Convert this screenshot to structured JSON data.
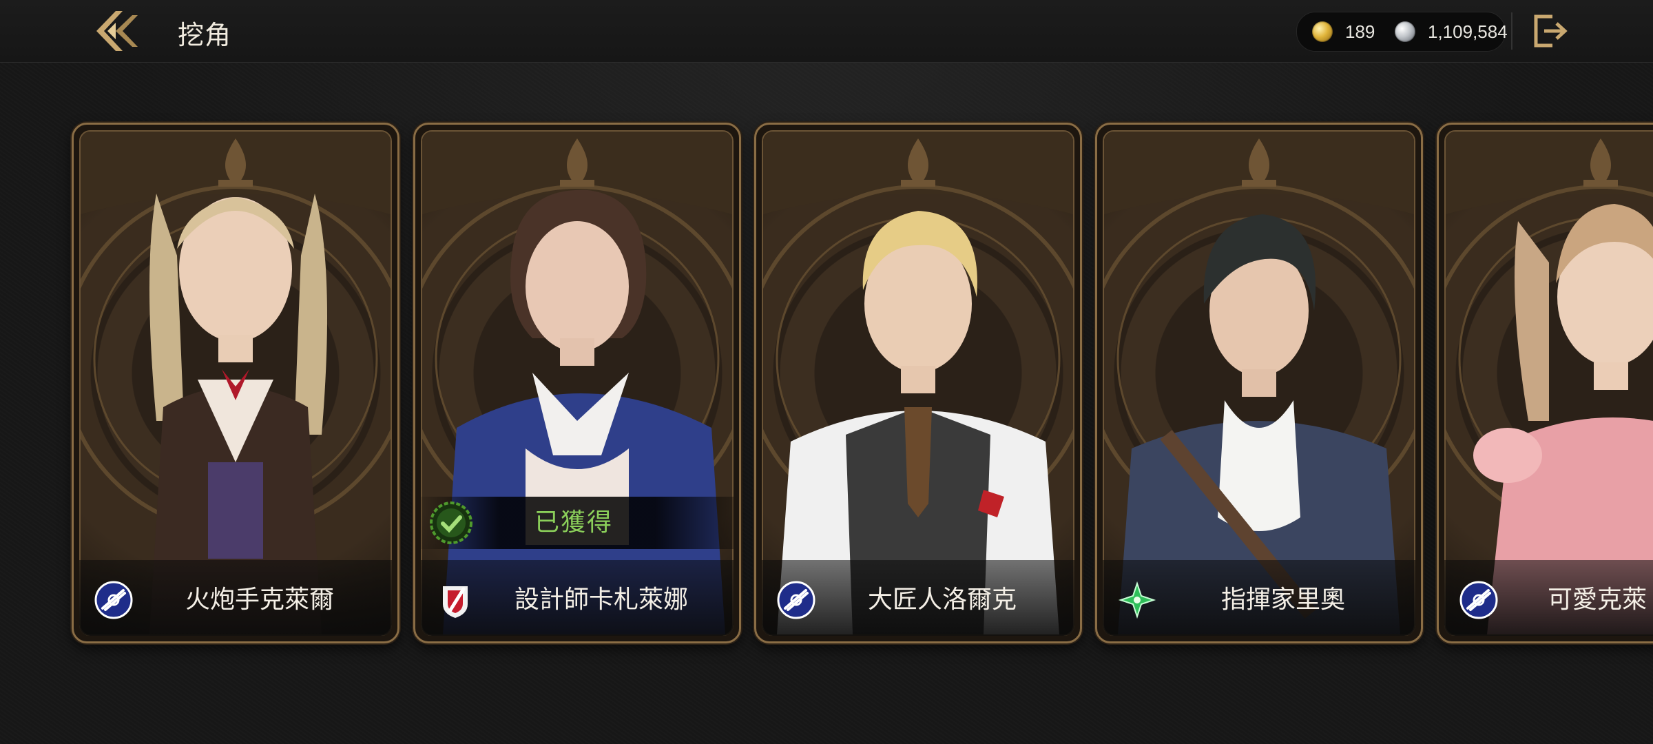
{
  "header": {
    "title": "挖角",
    "back_icon": "double-chevron-left-icon",
    "exit_icon": "exit-icon"
  },
  "currency": {
    "gold": "189",
    "silver": "1,109,584"
  },
  "cards": [
    {
      "name": "火炮手克萊爾",
      "class_icon": "gunner-class-icon",
      "obtained": false
    },
    {
      "name": "設計師卡札萊娜",
      "class_icon": "designer-class-icon",
      "obtained": true,
      "obtained_label": "已獲得"
    },
    {
      "name": "大匠人洛爾克",
      "class_icon": "gunner-class-icon",
      "obtained": false
    },
    {
      "name": "指揮家里奧",
      "class_icon": "commander-class-icon",
      "obtained": false
    },
    {
      "name": "可愛克萊",
      "class_icon": "gunner-class-icon",
      "obtained": false
    }
  ],
  "colors": {
    "frame_gold": "#8a6d45",
    "obtained_green": "#8bcf5a",
    "class_blue": "#2a3fae"
  }
}
